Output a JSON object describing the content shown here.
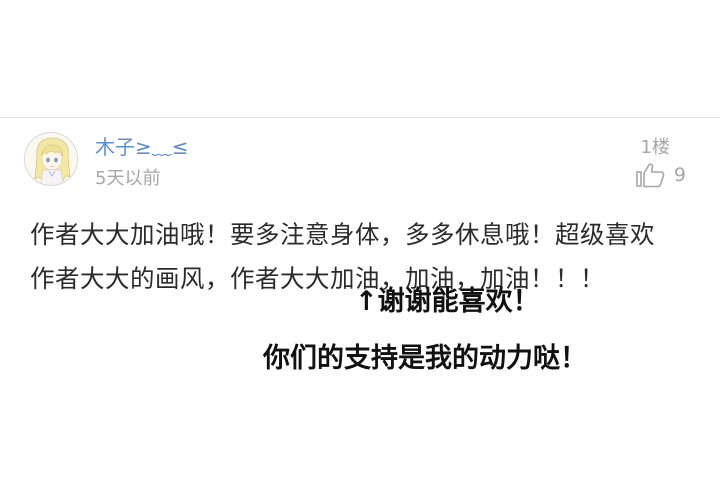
{
  "comment": {
    "username": "木子≥﹏≤",
    "timestamp": "5天以前",
    "floor": "1楼",
    "like_count": "9",
    "body": "作者大大加油哦！要多注意身体，多多休息哦！超级喜欢作者大大的画风，作者大大加油，加油，加油！！！"
  },
  "reply": {
    "line1": "↑谢谢能喜欢！",
    "line2": "你们的支持是我的动力哒！"
  },
  "colors": {
    "username": "#5d8fc9",
    "meta": "#a6a6a6",
    "body": "#2b2b2b",
    "reply": "#111111"
  },
  "icons": {
    "avatar": "anime-girl-avatar",
    "like": "thumbs-up-icon"
  }
}
